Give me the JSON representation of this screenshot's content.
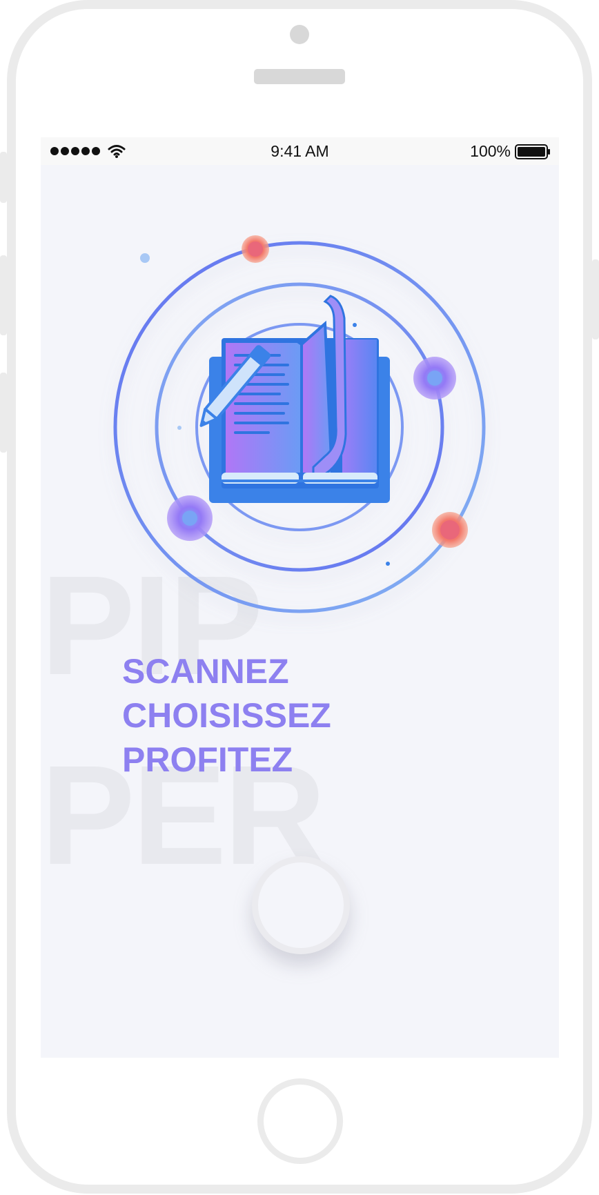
{
  "status_bar": {
    "time": "9:41 AM",
    "battery": "100%",
    "signal_bars": 5
  },
  "watermark": {
    "line1": "PIP",
    "line2": "PER"
  },
  "hero": {
    "icon": "open-book-with-pencil-icon",
    "colors": {
      "orbit_blue": "#6a7cf0",
      "orbit_light": "#84aaf2",
      "book_blue": "#3b82e8",
      "page_purple": "#b078f5",
      "dot_orange": "#f5806a",
      "dot_purple": "#8b7cf5"
    }
  },
  "tagline": {
    "line1": "SCANNEZ",
    "line2": "CHOISISSEZ",
    "line3": "PROFITEZ",
    "color": "#8d80f0"
  },
  "action_button": {
    "icon": "circle-button"
  },
  "device": {
    "home_button": "home-button"
  }
}
